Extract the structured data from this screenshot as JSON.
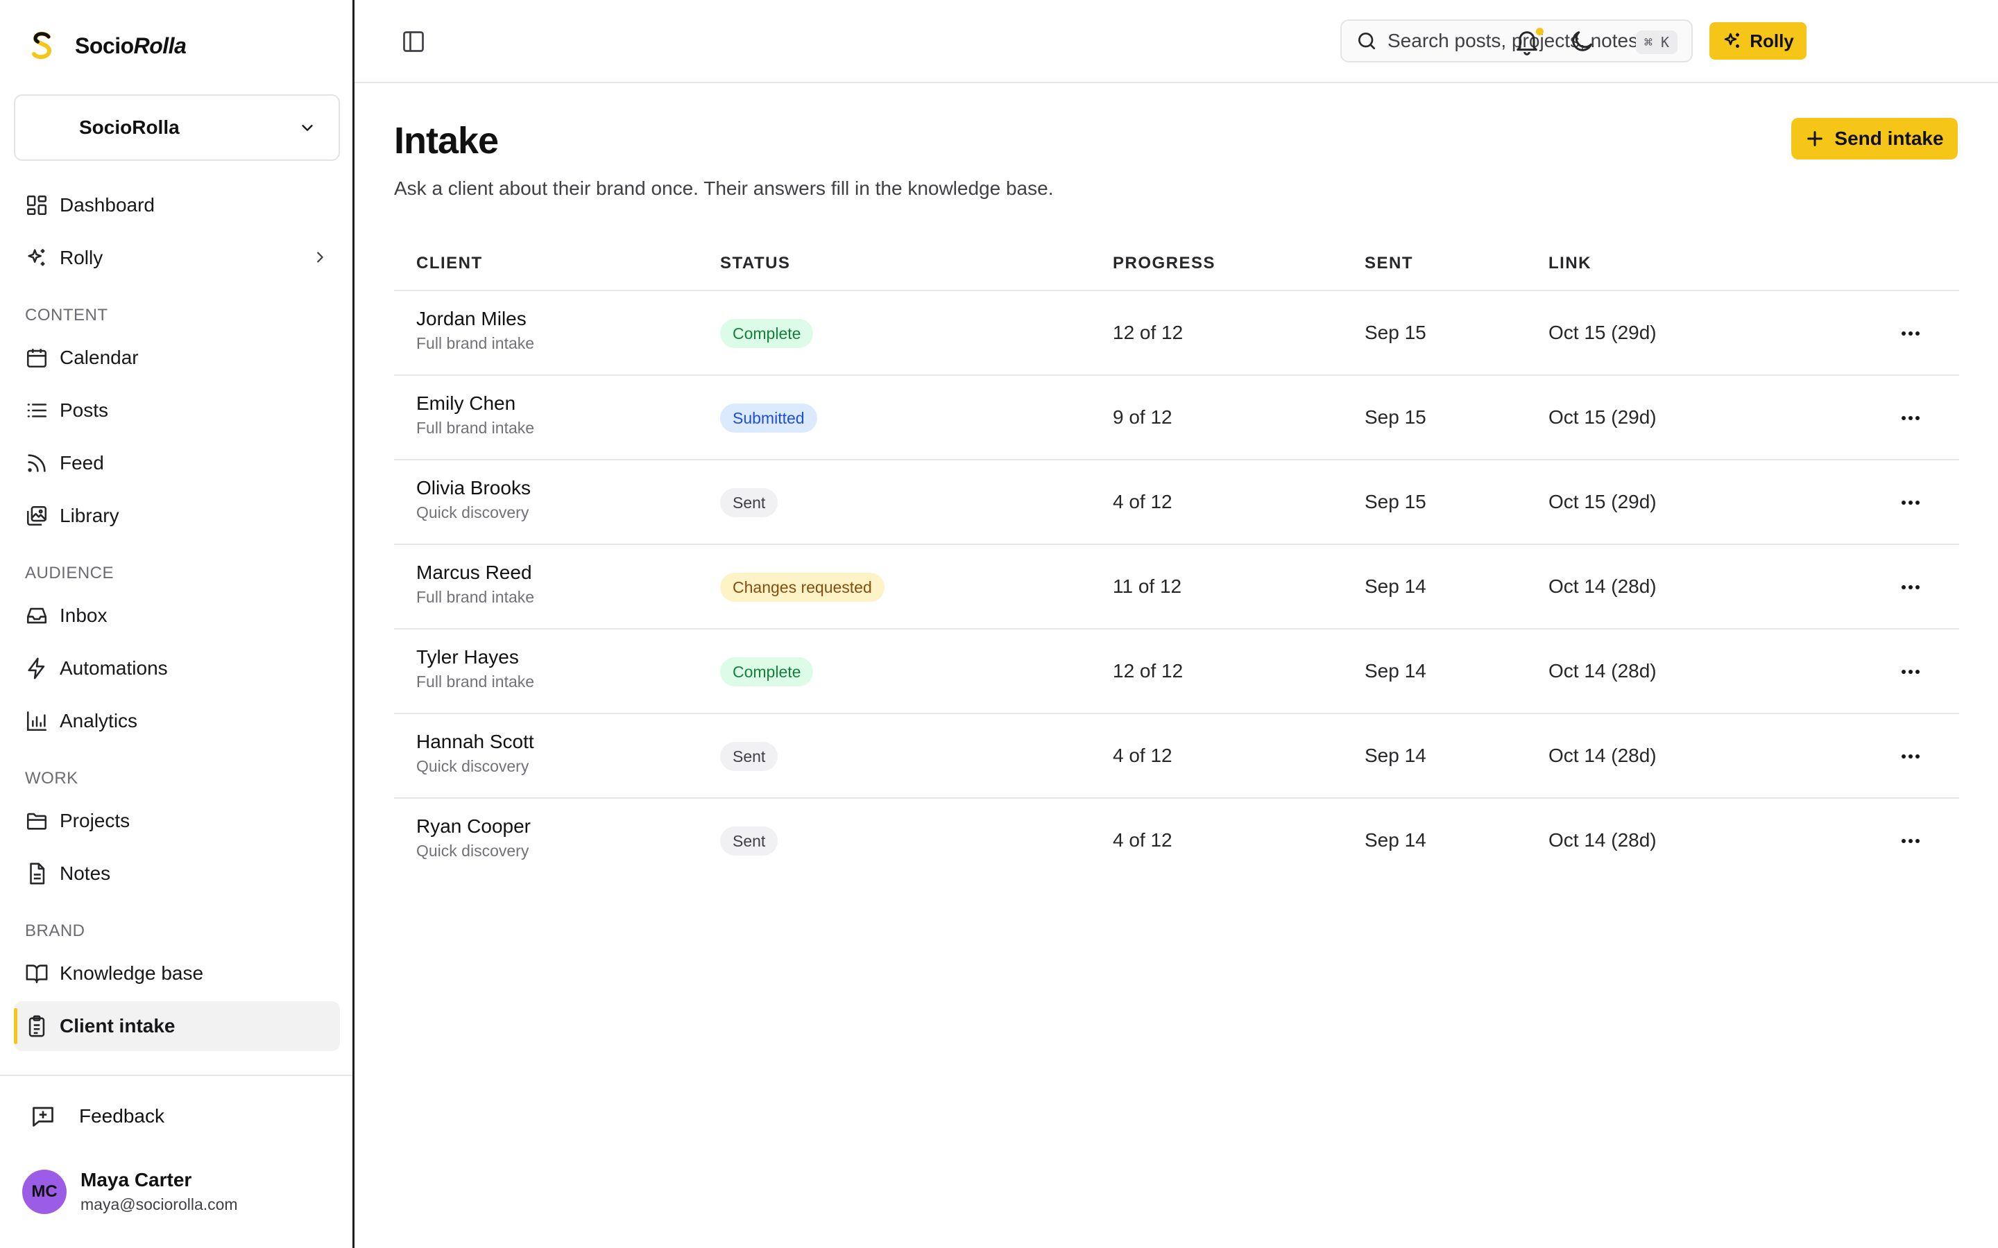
{
  "brand": {
    "name_plain": "Socio",
    "name_italic": "Rolla"
  },
  "workspace": {
    "name": "SocioRolla"
  },
  "nav": {
    "dashboard": "Dashboard",
    "rolly": "Rolly",
    "sections": {
      "content": "CONTENT",
      "audience": "AUDIENCE",
      "work": "WORK",
      "brand": "BRAND"
    },
    "calendar": "Calendar",
    "posts": "Posts",
    "feed": "Feed",
    "library": "Library",
    "inbox": "Inbox",
    "automations": "Automations",
    "analytics": "Analytics",
    "projects": "Projects",
    "notes": "Notes",
    "knowledge_base": "Knowledge base",
    "client_intake": "Client intake"
  },
  "feedback": "Feedback",
  "user": {
    "initials": "MC",
    "name": "Maya Carter",
    "email": "maya@sociorolla.com"
  },
  "topbar": {
    "search_placeholder": "Search posts, projects, notes...",
    "search_shortcut": "⌘ K",
    "rolly_label": "Rolly"
  },
  "page": {
    "title": "Intake",
    "subtitle": "Ask a client about their brand once. Their answers fill in the knowledge base.",
    "send_label": "Send intake"
  },
  "table": {
    "headers": {
      "client": "CLIENT",
      "status": "STATUS",
      "progress": "PROGRESS",
      "sent": "SENT",
      "link": "LINK"
    },
    "rows": [
      {
        "name": "Jordan Miles",
        "type": "Full brand intake",
        "status": "Complete",
        "progress": "12 of 12",
        "sent": "Sep 15",
        "link": "Oct 15 (29d)"
      },
      {
        "name": "Emily Chen",
        "type": "Full brand intake",
        "status": "Submitted",
        "progress": "9 of 12",
        "sent": "Sep 15",
        "link": "Oct 15 (29d)"
      },
      {
        "name": "Olivia Brooks",
        "type": "Quick discovery",
        "status": "Sent",
        "progress": "4 of 12",
        "sent": "Sep 15",
        "link": "Oct 15 (29d)"
      },
      {
        "name": "Marcus Reed",
        "type": "Full brand intake",
        "status": "Changes requested",
        "progress": "11 of 12",
        "sent": "Sep 14",
        "link": "Oct 14 (28d)"
      },
      {
        "name": "Tyler Hayes",
        "type": "Full brand intake",
        "status": "Complete",
        "progress": "12 of 12",
        "sent": "Sep 14",
        "link": "Oct 14 (28d)"
      },
      {
        "name": "Hannah Scott",
        "type": "Quick discovery",
        "status": "Sent",
        "progress": "4 of 12",
        "sent": "Sep 14",
        "link": "Oct 14 (28d)"
      },
      {
        "name": "Ryan Cooper",
        "type": "Quick discovery",
        "status": "Sent",
        "progress": "4 of 12",
        "sent": "Sep 14",
        "link": "Oct 14 (28d)"
      }
    ]
  },
  "colors": {
    "accent": "#f5c518",
    "avatar": "#9b5de5",
    "complete": "#15803d",
    "submitted": "#1d4ed8",
    "changes": "#854d0e"
  }
}
